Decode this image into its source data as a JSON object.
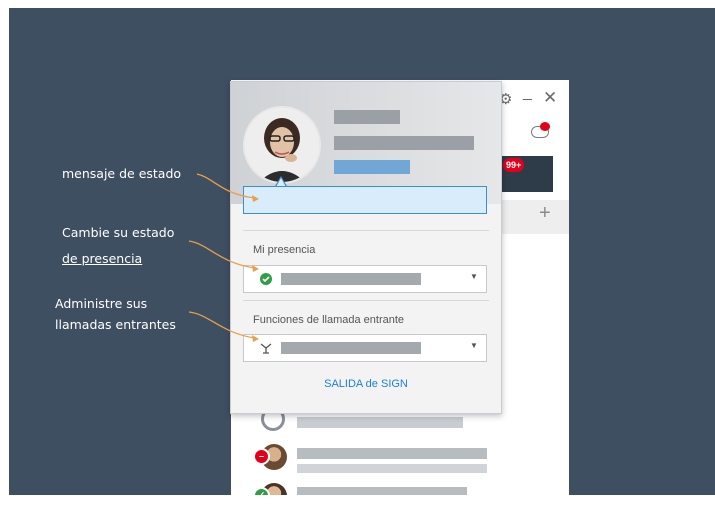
{
  "annotations": {
    "status_message": "mensaje de estado",
    "change_presence_line1": "Cambie su estado",
    "change_presence_line2": "de presencia",
    "manage_calls_line1": "Administre sus",
    "manage_calls_line2": "llamadas entrantes"
  },
  "background_app": {
    "badge": "99+",
    "add_tab": "+"
  },
  "popup": {
    "presence_label": "Mi presencia",
    "calls_label": "Funciones de llamada entrante",
    "sign_out": "SALIDA de SIGN"
  },
  "colors": {
    "backdrop": "#3f4f62",
    "accent_blue": "#1c7fd6",
    "available_green": "#2f9e44",
    "busy_red": "#e2001a",
    "annotation_arrow": "#e8a04a"
  }
}
